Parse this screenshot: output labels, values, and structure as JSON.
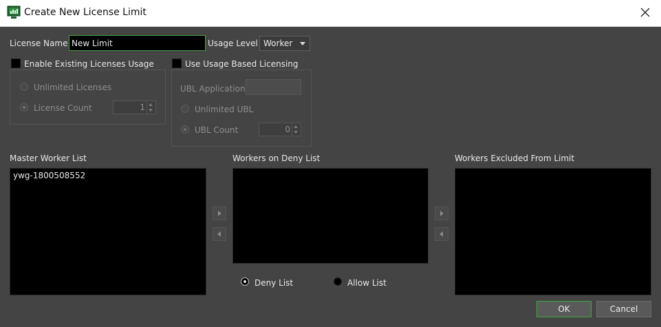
{
  "window": {
    "title": "Create New License Limit"
  },
  "license_name": {
    "label": "License Name",
    "value": "New Limit"
  },
  "usage_level": {
    "label": "Usage Level",
    "selected": "Worker"
  },
  "existing_licenses": {
    "checkbox_label": "Enable Existing Licenses Usage",
    "checked": false,
    "unlimited_label": "Unlimited Licenses",
    "count_label": "License Count",
    "count_value": "1"
  },
  "usage_based": {
    "checkbox_label": "Use Usage Based Licensing",
    "checked": false,
    "application_label": "UBL Application",
    "unlimited_label": "Unlimited UBL",
    "count_label": "UBL Count",
    "count_value": "0"
  },
  "lists": {
    "master_label": "Master Worker List",
    "master_items": [
      "ywg-1800508552"
    ],
    "deny_label": "Workers on Deny List",
    "excluded_label": "Workers Excluded From Limit"
  },
  "list_mode": {
    "deny_label": "Deny List",
    "allow_label": "Allow List",
    "selected": "Deny List"
  },
  "buttons": {
    "ok": "OK",
    "cancel": "Cancel"
  },
  "colors": {
    "background": "#444444",
    "accent_green": "#47a547",
    "list_background": "#000000"
  }
}
